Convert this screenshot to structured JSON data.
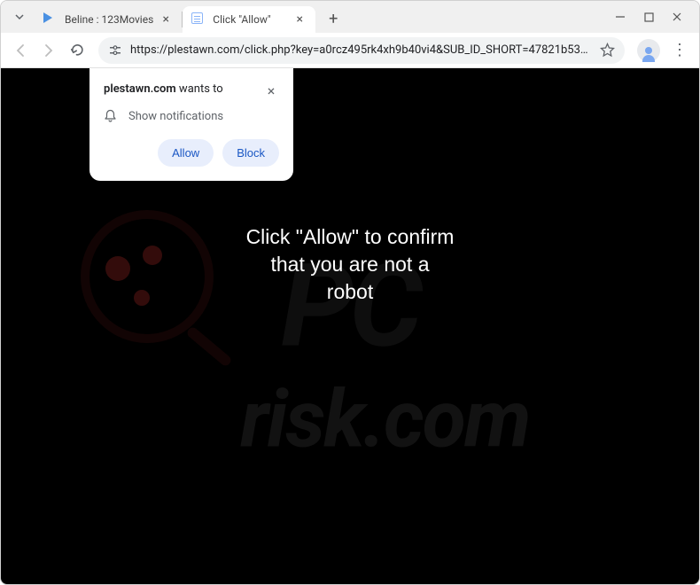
{
  "tabs": [
    {
      "title": "Beline : 123Movies",
      "active": false
    },
    {
      "title": "Click \"Allow\"",
      "active": true
    }
  ],
  "url": "https://plestawn.com/click.php?key=a0rcz495rk4xh9b40vi4&SUB_ID_SHORT=47821b53c6a0cdc8768276db6b816355&...",
  "prompt": {
    "domain": "plestawn.com",
    "wants": " wants to",
    "permission": "Show notifications",
    "allow": "Allow",
    "block": "Block"
  },
  "page_message": "Click \"Allow\" to confirm\nthat you are not a\nrobot",
  "watermark": {
    "line1": "PC",
    "line2": "risk.com"
  }
}
